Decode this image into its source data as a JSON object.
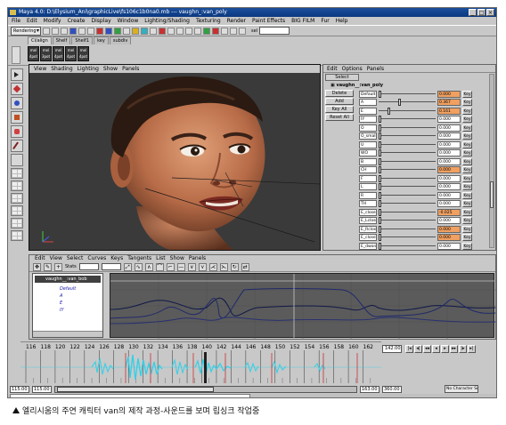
{
  "window": {
    "title": "Maya 4.0: D:\\Elysium_Ani\\graphicLive\\fs106c1b0na0.mb  ---  vaughn_:van_poly"
  },
  "menubar": [
    "File",
    "Edit",
    "Modify",
    "Create",
    "Display",
    "Window",
    "Lighting/Shading",
    "Texturing",
    "Render",
    "Paint Effects",
    "BIG FILM",
    "Fur",
    "Help"
  ],
  "status_line": {
    "mode": "Rendering",
    "selection_label": "sel"
  },
  "shelf": {
    "tabs": [
      "Cl/align",
      "Shelf",
      "Shelf1",
      "key",
      "subdiv"
    ],
    "active_tab": "Cl/align",
    "buttons": [
      {
        "top": "mel",
        "bottom": "4pot"
      },
      {
        "top": "mel",
        "bottom": "3pot"
      },
      {
        "top": "mel",
        "bottom": "4pot"
      },
      {
        "top": "mel",
        "bottom": "4pot"
      },
      {
        "top": "mel",
        "bottom": "4pot"
      }
    ]
  },
  "viewport": {
    "menu": [
      "View",
      "Shading",
      "Lighting",
      "Show",
      "Panels"
    ]
  },
  "channel_box": {
    "menu": [
      "Edit",
      "Options",
      "Panels"
    ],
    "select_button": "Select",
    "node_name": "vaughn__:van_poly",
    "side_buttons": [
      "Delete",
      "Add",
      "Key All",
      "Reset All"
    ],
    "rows": [
      {
        "name": "Default",
        "value": "0.000",
        "keyed": true,
        "key": "Key"
      },
      {
        "name": "A",
        "value": "0.367",
        "keyed": true,
        "key": "Key"
      },
      {
        "name": "E",
        "value": "0.161",
        "keyed": true,
        "key": "Key"
      },
      {
        "name": "IY",
        "value": "0.000",
        "keyed": false,
        "key": "Key"
      },
      {
        "name": "O",
        "value": "0.000",
        "keyed": false,
        "key": "Key"
      },
      {
        "name": "O_small",
        "value": "0.000",
        "keyed": false,
        "key": "Key"
      },
      {
        "name": "U",
        "value": "0.000",
        "keyed": false,
        "key": "Key"
      },
      {
        "name": "WO",
        "value": "0.000",
        "keyed": false,
        "key": "Key"
      },
      {
        "name": "B",
        "value": "0.000",
        "keyed": false,
        "key": "Key"
      },
      {
        "name": "CH",
        "value": "0.000",
        "keyed": true,
        "key": "Key"
      },
      {
        "name": "F",
        "value": "0.000",
        "keyed": false,
        "key": "Key"
      },
      {
        "name": "L",
        "value": "0.000",
        "keyed": false,
        "key": "Key"
      },
      {
        "name": "R",
        "value": "0.000",
        "keyed": false,
        "key": "Key"
      },
      {
        "name": "TH",
        "value": "0.000",
        "keyed": false,
        "key": "Key"
      },
      {
        "name": "E_close",
        "value": "-0.025",
        "keyed": true,
        "key": "Key"
      },
      {
        "name": "E_Lclose",
        "value": "0.000",
        "keyed": false,
        "key": "Key"
      },
      {
        "name": "E_Rclos",
        "value": "0.000",
        "keyed": true,
        "key": "Key"
      },
      {
        "name": "E_closeT",
        "value": "0.000",
        "keyed": true,
        "key": "Key"
      },
      {
        "name": "E_dwon",
        "value": "0.000",
        "keyed": false,
        "key": "Key"
      }
    ]
  },
  "graph_editor": {
    "menu": [
      "Edit",
      "View",
      "Select",
      "Curves",
      "Keys",
      "Tangents",
      "List",
      "Show",
      "Panels"
    ],
    "stats_label": "Stats",
    "node_name": "vaughn__:van_bob",
    "attributes": [
      "Default",
      "A",
      "E",
      "IY"
    ]
  },
  "time_slider": {
    "tick_labels": [
      "116",
      "118",
      "120",
      "122",
      "124",
      "126",
      "128",
      "130",
      "132",
      "134",
      "136",
      "138",
      "140",
      "142",
      "144",
      "146",
      "148",
      "150",
      "152",
      "154",
      "156",
      "158",
      "160",
      "162"
    ],
    "current_frame": "142.00"
  },
  "range_slider": {
    "start": "115.00",
    "inner_start": "115.00",
    "inner_end": "163.00",
    "end": "360.00",
    "character_set": "No Character Set"
  },
  "caption": "엘리시움의 주연 캐릭터 van의 제작 과정-사운드를 보며 립싱크 작업중",
  "colors": {
    "ui_gray": "#c8c8c8",
    "title_blue": "#0a3880",
    "keyed_orange": "#f0a060",
    "audio_cyan": "#30d0e8",
    "viewport_bg": "#3a3a3a"
  }
}
